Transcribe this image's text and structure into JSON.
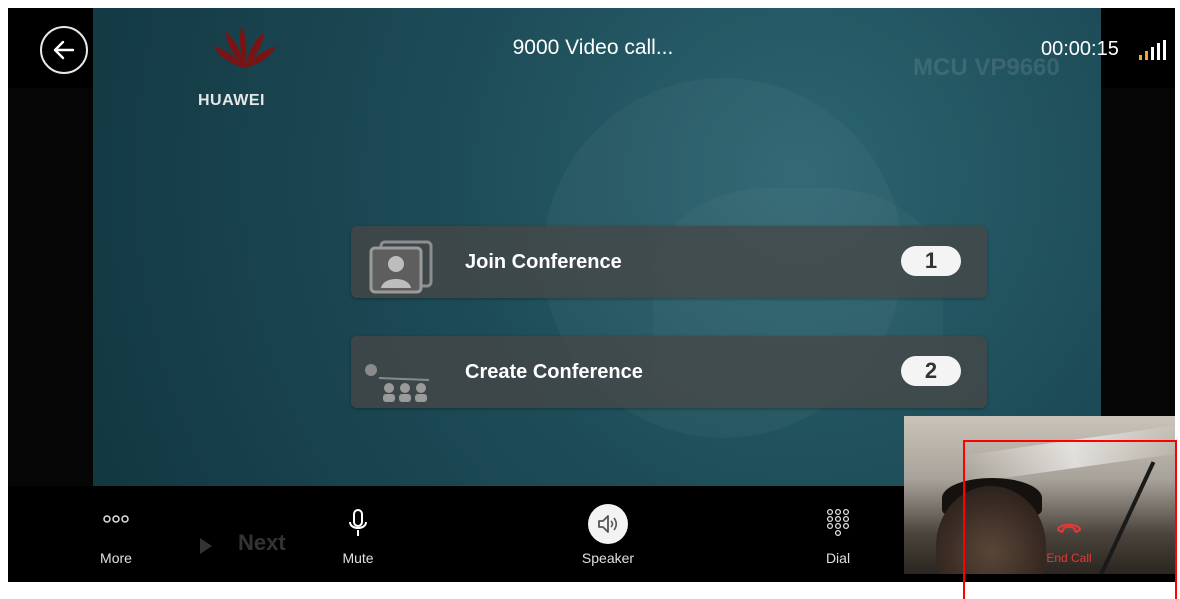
{
  "header": {
    "title": "9000  Video call...",
    "timer": "00:00:15",
    "back_icon": "back-arrow-icon",
    "signal_icon": "signal-strength-icon"
  },
  "video": {
    "brand_text": "HUAWEI",
    "watermark_text": "MCU VP9660",
    "menu_items": [
      {
        "label": "Join Conference",
        "number": "1",
        "icon": "join-conference-icon"
      },
      {
        "label": "Create Conference",
        "number": "2",
        "icon": "create-conference-icon"
      }
    ],
    "next_hint": "Next"
  },
  "controls": {
    "more": {
      "label": "More",
      "icon": "more-dots-icon"
    },
    "mute": {
      "label": "Mute",
      "icon": "microphone-icon"
    },
    "speaker": {
      "label": "Speaker",
      "icon": "speaker-icon"
    },
    "dial": {
      "label": "Dial",
      "icon": "dialpad-icon"
    },
    "end_call": {
      "label": "End Call",
      "icon": "hang-up-icon"
    }
  },
  "colors": {
    "end_call": "#e53935",
    "highlight": "#ff0000",
    "signal_active": "#f5a623"
  }
}
